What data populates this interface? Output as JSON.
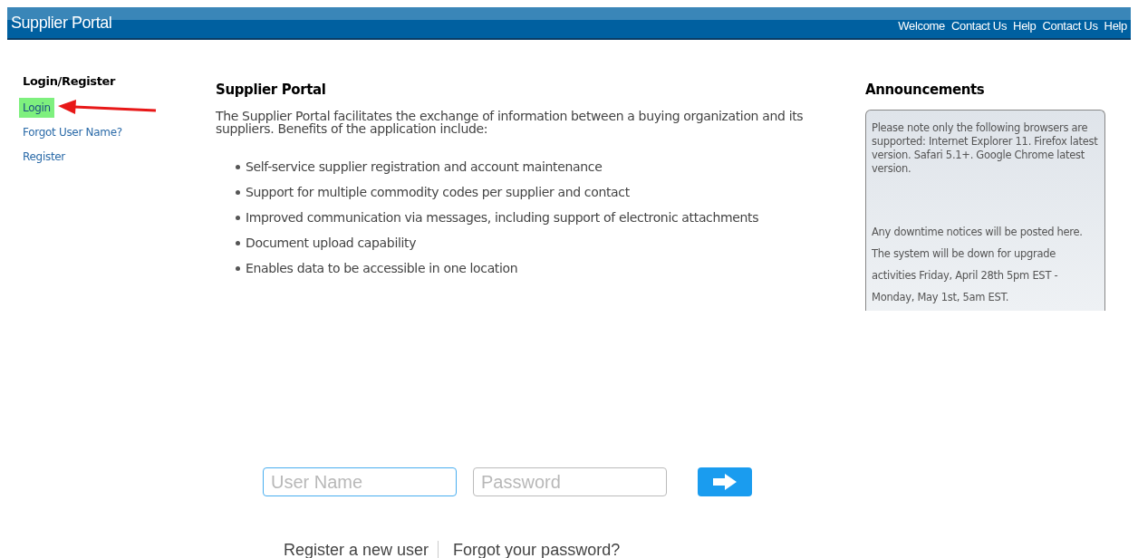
{
  "header": {
    "title": "Supplier Portal",
    "links": [
      "Welcome",
      "Contact Us",
      "Help",
      "Contact Us",
      "Help"
    ]
  },
  "sidebar": {
    "title": "Login/Register",
    "items": [
      {
        "label": "Login",
        "selected": true
      },
      {
        "label": "Forgot User Name?",
        "selected": false
      },
      {
        "label": "Register",
        "selected": false
      }
    ]
  },
  "main": {
    "title": "Supplier Portal",
    "intro": "The Supplier Portal facilitates the exchange of information between a buying organization and its suppliers. Benefits of the application include:",
    "benefits": [
      "Self-service supplier registration and account maintenance",
      "Support for multiple commodity codes per supplier and contact",
      "Improved communication via messages, including support of electronic attachments",
      "Document upload capability",
      "Enables data to be accessible in one location"
    ]
  },
  "announcements": {
    "title": "Announcements",
    "notes": [
      "Please note only the following browsers are supported: Internet Explorer 11. Firefox latest version. Safari 5.1+. Google Chrome latest version.",
      "Any downtime notices will be posted here.  The system will be down for upgrade activities Friday, April 28th 5pm EST - Monday, May 1st, 5am EST."
    ]
  },
  "login_form": {
    "fields": [
      {
        "placeholder": "User Name",
        "focused": true
      },
      {
        "placeholder": "Password",
        "focused": false
      }
    ],
    "links": [
      "Register a new user",
      "Forgot your password?"
    ]
  }
}
